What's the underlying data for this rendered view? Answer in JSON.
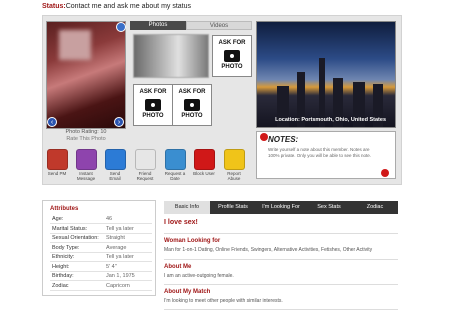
{
  "status": {
    "label": "Status:",
    "text": "Contact me and ask me about my status"
  },
  "photos": {
    "tabs": [
      "Photos",
      "Videos"
    ],
    "rating": "Photo Rating: 10",
    "rate_link": "Rate This Photo",
    "ask_label_1": "ASK FOR",
    "ask_label_2": "PHOTO"
  },
  "location": {
    "caption": "Location: Portsmouth, Ohio, United States"
  },
  "actions": [
    {
      "label": "Send PM",
      "icon": "send-pm-icon",
      "color": "#c0392b"
    },
    {
      "label": "Instant Message",
      "icon": "instant-message-icon",
      "color": "#8e44ad"
    },
    {
      "label": "Send Email",
      "icon": "send-email-icon",
      "color": "#2c7bd6"
    },
    {
      "label": "Friend Request",
      "icon": "friend-request-icon",
      "color": "#e6e6e6"
    },
    {
      "label": "Request a Date",
      "icon": "request-date-icon",
      "color": "#3a8ed0"
    },
    {
      "label": "Block User",
      "icon": "block-user-icon",
      "color": "#d01818"
    },
    {
      "label": "Report Abuse",
      "icon": "report-abuse-icon",
      "color": "#f0c419"
    }
  ],
  "notes": {
    "title": "NOTES:",
    "text": "Write yourself a note about this member. Notes are 100% private. Only you will be able to see this note."
  },
  "attributes": {
    "title": "Attributes",
    "rows": [
      {
        "k": "Age:",
        "v": "46"
      },
      {
        "k": "Marital Status:",
        "v": "Tell ya later"
      },
      {
        "k": "Sexual Orientation:",
        "v": "Straight"
      },
      {
        "k": "Body Type:",
        "v": "Average"
      },
      {
        "k": "Ethnicity:",
        "v": "Tell ya later"
      },
      {
        "k": "Height:",
        "v": "5' 4\""
      },
      {
        "k": "Birthday:",
        "v": "Jan 1, 1975"
      },
      {
        "k": "Zodiac",
        "v": "Capricorn"
      }
    ]
  },
  "right_tabs": [
    "Basic Info",
    "Profile Stats",
    "I'm Looking For",
    "Sex Stats",
    "Zodiac"
  ],
  "profile": {
    "headline": "I love sex!",
    "looking_for_title": "Woman Looking for",
    "looking_for_text": "Man for 1-on-1 Dating, Online Friends, Swingers, Alternative Activities, Fetishes, Other Activity",
    "about_title": "About Me",
    "about_text": "I am an active-outgoing female.",
    "match_title": "About My Match",
    "match_text": "I'm looking to meet other people with similar interests."
  }
}
